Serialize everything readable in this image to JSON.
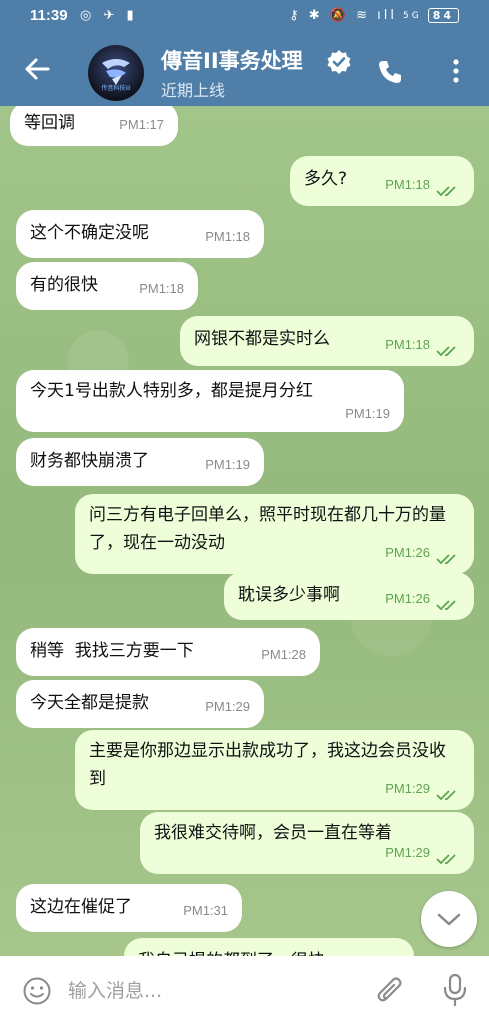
{
  "status_bar": {
    "time": "11:39",
    "left_icons": "◎ ✈ ▮",
    "right_icons": "⚷ ✱ 🔕 ≋ ıll",
    "network": "5G",
    "battery": "84"
  },
  "header": {
    "title": "傳音II事务处理",
    "subtitle": "近期上线",
    "avatar_text": "传音科技III"
  },
  "messages": [
    {
      "dir": "in",
      "text": "等回调",
      "time": "PM1:17"
    },
    {
      "dir": "out",
      "text": "多久?",
      "time": "PM1:18"
    },
    {
      "dir": "in",
      "text": "这个不确定没呢",
      "time": "PM1:18"
    },
    {
      "dir": "in",
      "text": "有的很快",
      "time": "PM1:18"
    },
    {
      "dir": "out",
      "text": "网银不都是实时么",
      "time": "PM1:18"
    },
    {
      "dir": "in",
      "text": "今天1号出款人特别多，都是提月分红",
      "time": "PM1:19"
    },
    {
      "dir": "in",
      "text": "财务都快崩溃了",
      "time": "PM1:19"
    },
    {
      "dir": "out",
      "text": "问三方有电子回单么，照平时现在都几十万的量了，现在一动没动",
      "time": "PM1:26"
    },
    {
      "dir": "out",
      "text": "耽误多少事啊",
      "time": "PM1:26"
    },
    {
      "dir": "in",
      "text": "稍等  我找三方要一下",
      "time": "PM1:28"
    },
    {
      "dir": "in",
      "text": "今天全都是提款",
      "time": "PM1:29"
    },
    {
      "dir": "out",
      "text": "主要是你那边显示出款成功了，我这边会员没收到",
      "time": "PM1:29"
    },
    {
      "dir": "out",
      "text": "我很难交待啊，会员一直在等着",
      "time": "PM1:29"
    },
    {
      "dir": "in",
      "text": "这边在催促了",
      "time": "PM1:31"
    },
    {
      "dir": "out",
      "text": "我自己提的都到了，很快",
      "time": ""
    }
  ],
  "input": {
    "placeholder": "输入消息..."
  },
  "colors": {
    "header": "#4f7ea8",
    "bubble_in": "#ffffff",
    "bubble_out": "#eefed9",
    "check": "#5aa54e"
  }
}
